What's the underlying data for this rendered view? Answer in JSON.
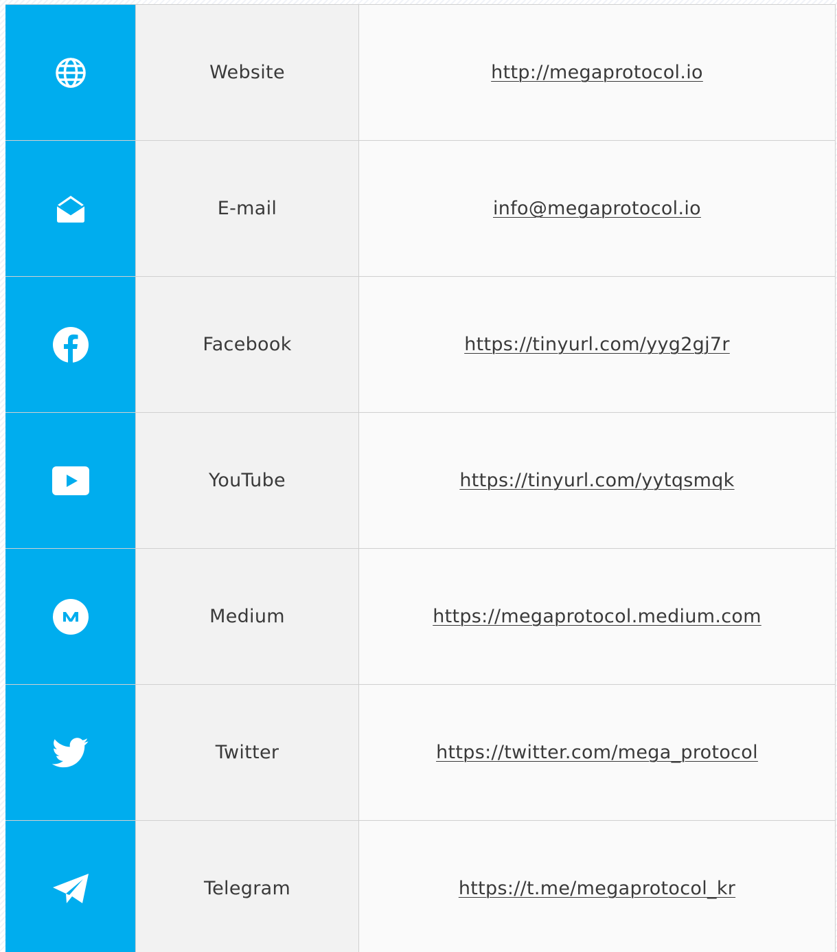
{
  "links": [
    {
      "icon": "globe-icon",
      "label": "Website",
      "value": "http://megaprotocol.io"
    },
    {
      "icon": "envelope-open-icon",
      "label": "E-mail",
      "value": "info@megaprotocol.io"
    },
    {
      "icon": "facebook-icon",
      "label": "Facebook",
      "value": "https://tinyurl.com/yyg2gj7r"
    },
    {
      "icon": "youtube-icon",
      "label": "YouTube",
      "value": "https://tinyurl.com/yytqsmqk"
    },
    {
      "icon": "medium-icon",
      "label": "Medium",
      "value": "https://megaprotocol.medium.com"
    },
    {
      "icon": "twitter-icon",
      "label": "Twitter",
      "value": "https://twitter.com/mega_protocol"
    },
    {
      "icon": "telegram-icon",
      "label": "Telegram",
      "value": "https://t.me/megaprotocol_kr"
    }
  ],
  "colors": {
    "accent": "#00adee",
    "label_bg": "#f2f2f2",
    "value_bg": "#fafafa",
    "text": "#3a3a3a",
    "border": "#d0d0d0"
  }
}
